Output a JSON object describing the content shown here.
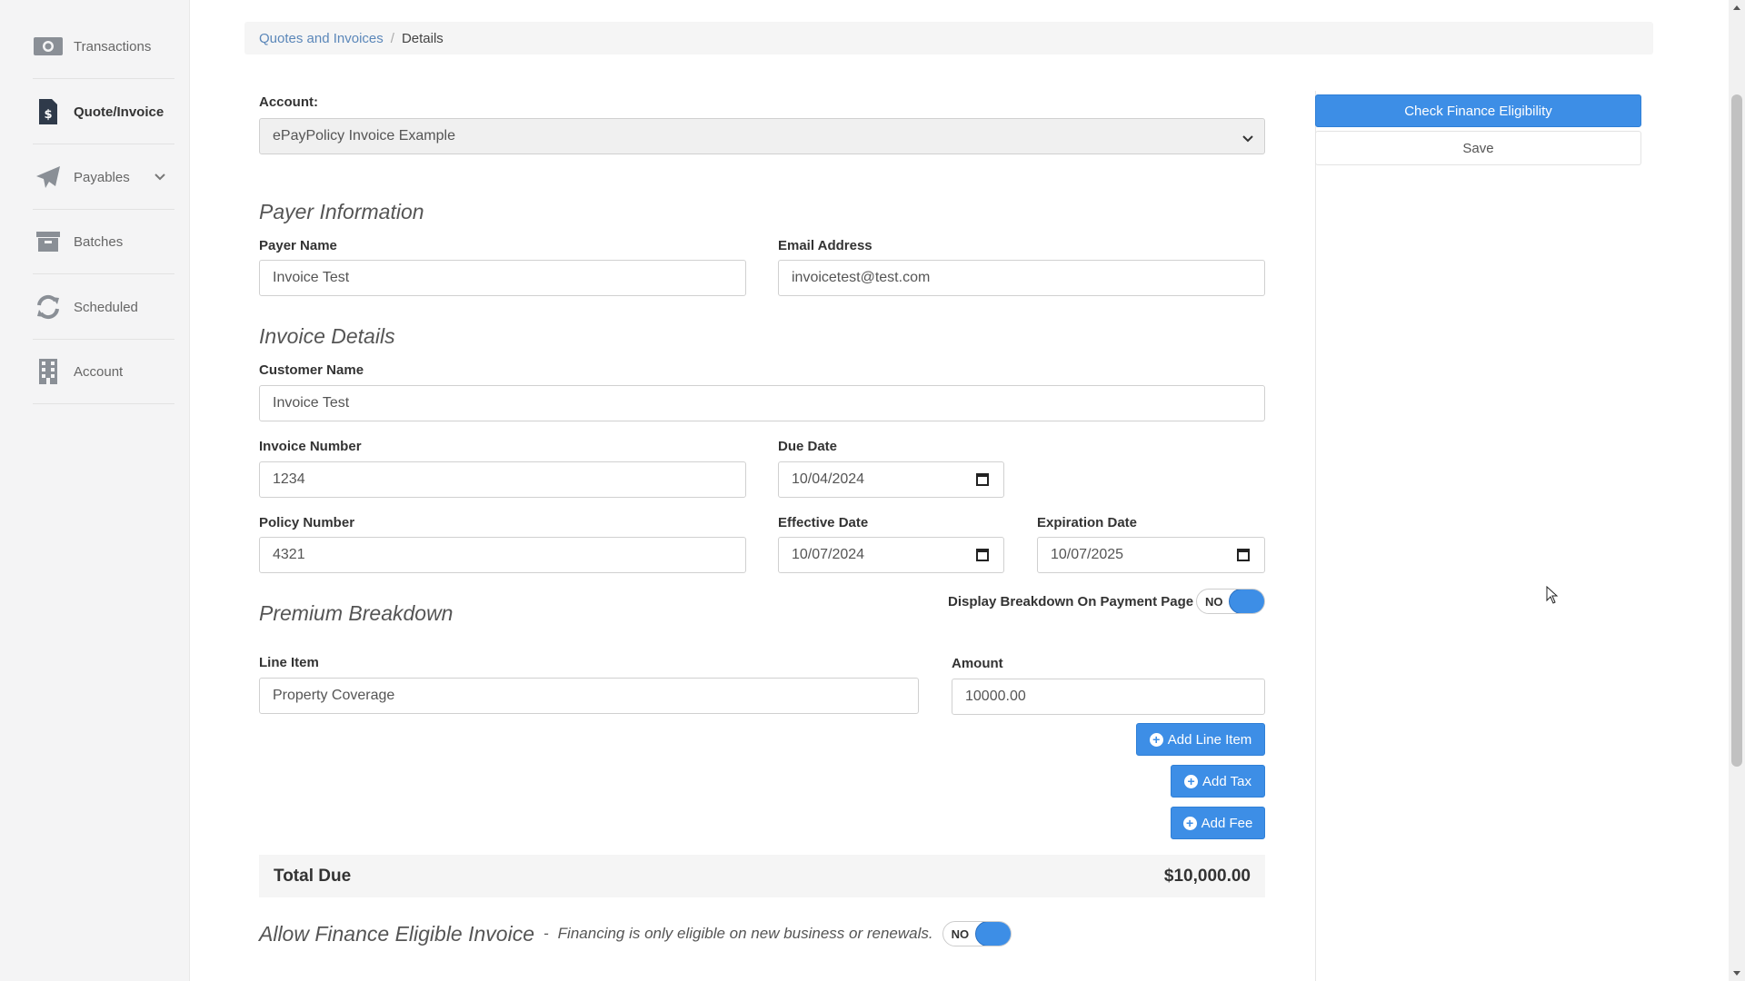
{
  "sidebar": {
    "items": [
      {
        "label": "Transactions",
        "icon": "money-icon",
        "active": false
      },
      {
        "label": "Quote/Invoice",
        "icon": "invoice-icon",
        "active": true
      },
      {
        "label": "Payables",
        "icon": "paper-plane-icon",
        "active": false,
        "has_submenu": true
      },
      {
        "label": "Batches",
        "icon": "archive-icon",
        "active": false
      },
      {
        "label": "Scheduled",
        "icon": "refresh-icon",
        "active": false
      },
      {
        "label": "Account",
        "icon": "building-icon",
        "active": false
      }
    ]
  },
  "breadcrumb": {
    "link": "Quotes and Invoices",
    "separator": "/",
    "current": "Details"
  },
  "account": {
    "label": "Account:",
    "selected": "ePayPolicy Invoice Example"
  },
  "payer_information": {
    "title": "Payer Information",
    "payer_name_label": "Payer Name",
    "payer_name": "Invoice Test",
    "email_label": "Email Address",
    "email": "invoicetest@test.com"
  },
  "invoice_details": {
    "title": "Invoice Details",
    "customer_name_label": "Customer Name",
    "customer_name": "Invoice Test",
    "invoice_number_label": "Invoice Number",
    "invoice_number": "1234",
    "due_date_label": "Due Date",
    "due_date": "10/04/2024",
    "policy_number_label": "Policy Number",
    "policy_number": "4321",
    "effective_date_label": "Effective Date",
    "effective_date": "10/07/2024",
    "expiration_date_label": "Expiration Date",
    "expiration_date": "10/07/2025"
  },
  "premium_breakdown": {
    "title": "Premium Breakdown",
    "display_toggle_label": "Display Breakdown On Payment Page",
    "display_toggle_state": "NO",
    "line_item_label": "Line Item",
    "line_item": "Property Coverage",
    "amount_label": "Amount",
    "amount": "10000.00",
    "add_line_item": "Add Line Item",
    "add_tax": "Add Tax",
    "add_fee": "Add Fee"
  },
  "total": {
    "label": "Total Due",
    "value": "$10,000.00"
  },
  "finance": {
    "title": "Allow Finance Eligible Invoice",
    "separator": "-",
    "description": "Financing is only eligible on new business or renewals.",
    "toggle_state": "NO"
  },
  "actions": {
    "check_finance": "Check Finance Eligibility",
    "save": "Save"
  },
  "colors": {
    "accent": "#3d8ee6",
    "link": "#5b87b9"
  }
}
